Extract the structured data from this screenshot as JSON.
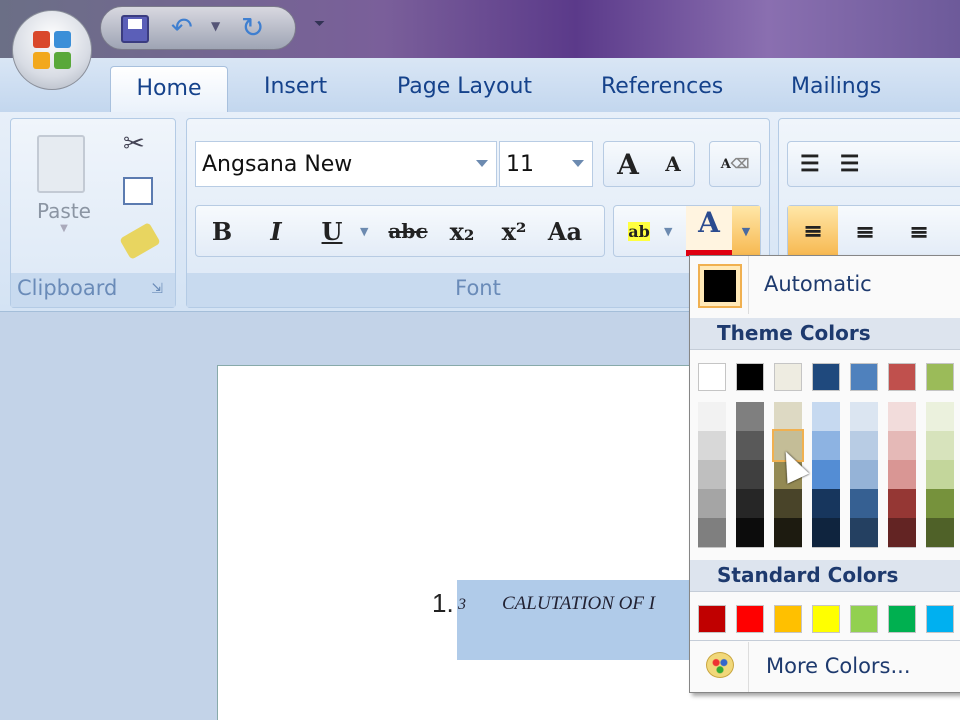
{
  "quick_access": {
    "save": "save-icon",
    "undo": "undo-icon",
    "redo": "redo-icon",
    "customize": "customize-icon"
  },
  "tabs": [
    "Home",
    "Insert",
    "Page Layout",
    "References",
    "Mailings"
  ],
  "clipboard": {
    "paste_label": "Paste",
    "group_label": "Clipboard"
  },
  "font": {
    "font_name": "Angsana New",
    "font_size": "11",
    "group_label": "Font",
    "bold": "B",
    "italic": "I",
    "underline": "U",
    "strike": "abc",
    "subscript": "x₂",
    "superscript": "x²",
    "change_case": "Aa",
    "grow": "A",
    "shrink": "A",
    "font_color": "A",
    "highlight": "ab"
  },
  "font_color_menu": {
    "automatic_label": "Automatic",
    "automatic_color": "#000000",
    "theme_header": "Theme Colors",
    "theme_colors": [
      "#FFFFFF",
      "#000000",
      "#EEECE1",
      "#1F497D",
      "#4F81BD",
      "#C0504D",
      "#9BBB59"
    ],
    "theme_shades": [
      [
        "#F2F2F2",
        "#D8D8D8",
        "#BFBFBF",
        "#A5A5A5",
        "#7F7F7F"
      ],
      [
        "#7F7F7F",
        "#595959",
        "#3F3F3F",
        "#262626",
        "#0C0C0C"
      ],
      [
        "#DDD9C3",
        "#C4BD97",
        "#938953",
        "#494429",
        "#1D1B10"
      ],
      [
        "#C6D9F0",
        "#8DB3E2",
        "#548DD4",
        "#17365D",
        "#0F243E"
      ],
      [
        "#DBE5F1",
        "#B8CCE4",
        "#95B3D7",
        "#366092",
        "#244061"
      ],
      [
        "#F2DCDB",
        "#E5B9B7",
        "#D99694",
        "#953734",
        "#632423"
      ],
      [
        "#EBF1DD",
        "#D7E3BC",
        "#C3D69B",
        "#76923C",
        "#4F6128"
      ]
    ],
    "highlighted_shade": "#C4BD97",
    "standard_header": "Standard Colors",
    "standard_colors": [
      "#C00000",
      "#FF0000",
      "#FFC000",
      "#FFFF00",
      "#92D050",
      "#00B050",
      "#00B0F0"
    ],
    "more_colors_label": "More Colors..."
  },
  "document": {
    "heading_number": "1.",
    "heading_sub": "3",
    "heading_text": "CALUTATION OF I"
  }
}
